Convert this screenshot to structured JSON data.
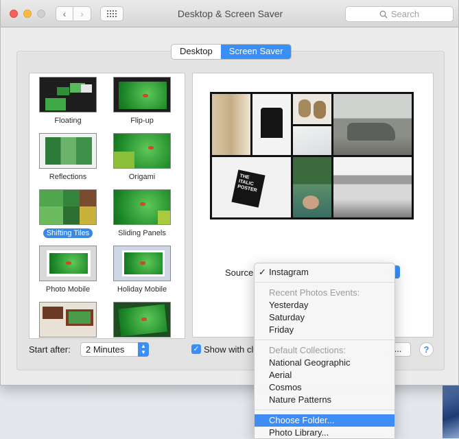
{
  "window": {
    "title": "Desktop & Screen Saver",
    "search_placeholder": "Search",
    "nav_back": "‹",
    "nav_forward": "›"
  },
  "tabs": [
    {
      "label": "Desktop",
      "active": false
    },
    {
      "label": "Screen Saver",
      "active": true
    }
  ],
  "screensavers": [
    {
      "label": "Floating"
    },
    {
      "label": "Flip-up"
    },
    {
      "label": "Reflections"
    },
    {
      "label": "Origami"
    },
    {
      "label": "Shifting Tiles",
      "selected": true
    },
    {
      "label": "Sliding Panels"
    },
    {
      "label": "Photo Mobile"
    },
    {
      "label": "Holiday Mobile"
    }
  ],
  "source": {
    "label": "Source:",
    "menu": {
      "selected": "Instagram",
      "check_glyph": "✓",
      "recent_header": "Recent Photos Events:",
      "recent": [
        "Yesterday",
        "Saturday",
        "Friday"
      ],
      "collections_header": "Default Collections:",
      "collections": [
        "National Geographic",
        "Aerial",
        "Cosmos",
        "Nature Patterns"
      ],
      "choose_folder": "Choose Folder...",
      "photo_library": "Photo Library..."
    }
  },
  "preview": {
    "poster_text": "THE\nITALIC\nPOSTER"
  },
  "footer": {
    "start_after_label": "Start after:",
    "start_after_value": "2 Minutes",
    "show_with_clock_label": "Show with cl",
    "show_with_clock_checked": true,
    "options_label": "...",
    "help_label": "?"
  },
  "colors": {
    "accent": "#3a8ff7",
    "selected_label": "#3b88e2"
  }
}
